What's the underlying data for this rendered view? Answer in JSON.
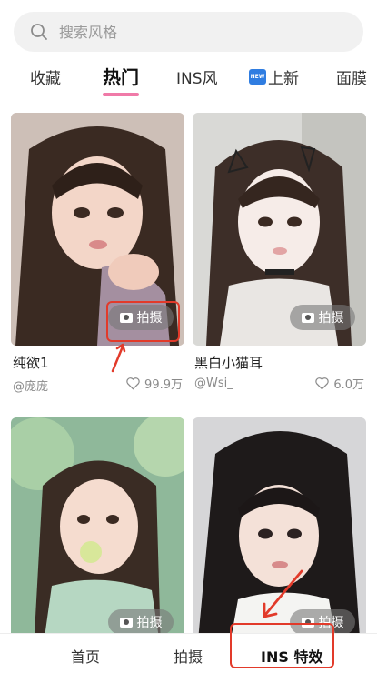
{
  "search": {
    "placeholder": "搜索风格"
  },
  "tabs": [
    {
      "label": "收藏"
    },
    {
      "label": "热门",
      "active": true
    },
    {
      "label": "INS风"
    },
    {
      "label": "上新",
      "badge": "NEW"
    },
    {
      "label": "面膜"
    }
  ],
  "cards": [
    {
      "title": "纯欲1",
      "author": "@庞庞",
      "likes": "99.9万",
      "button": "拍摄"
    },
    {
      "title": "黑白小猫耳",
      "author": "@Wsi_",
      "likes": "6.0万",
      "button": "拍摄"
    },
    {
      "title": "",
      "author": "",
      "likes": "",
      "button": "拍摄"
    },
    {
      "title": "",
      "author": "",
      "likes": "",
      "button": "拍摄"
    }
  ],
  "bottom_nav": [
    {
      "label": "首页"
    },
    {
      "label": "拍摄"
    },
    {
      "label": "INS 特效",
      "active": true
    }
  ],
  "colors": {
    "accent_underline": "#f07aa8",
    "annotation_red": "#e23a2a",
    "new_badge": "#2f7de1"
  }
}
